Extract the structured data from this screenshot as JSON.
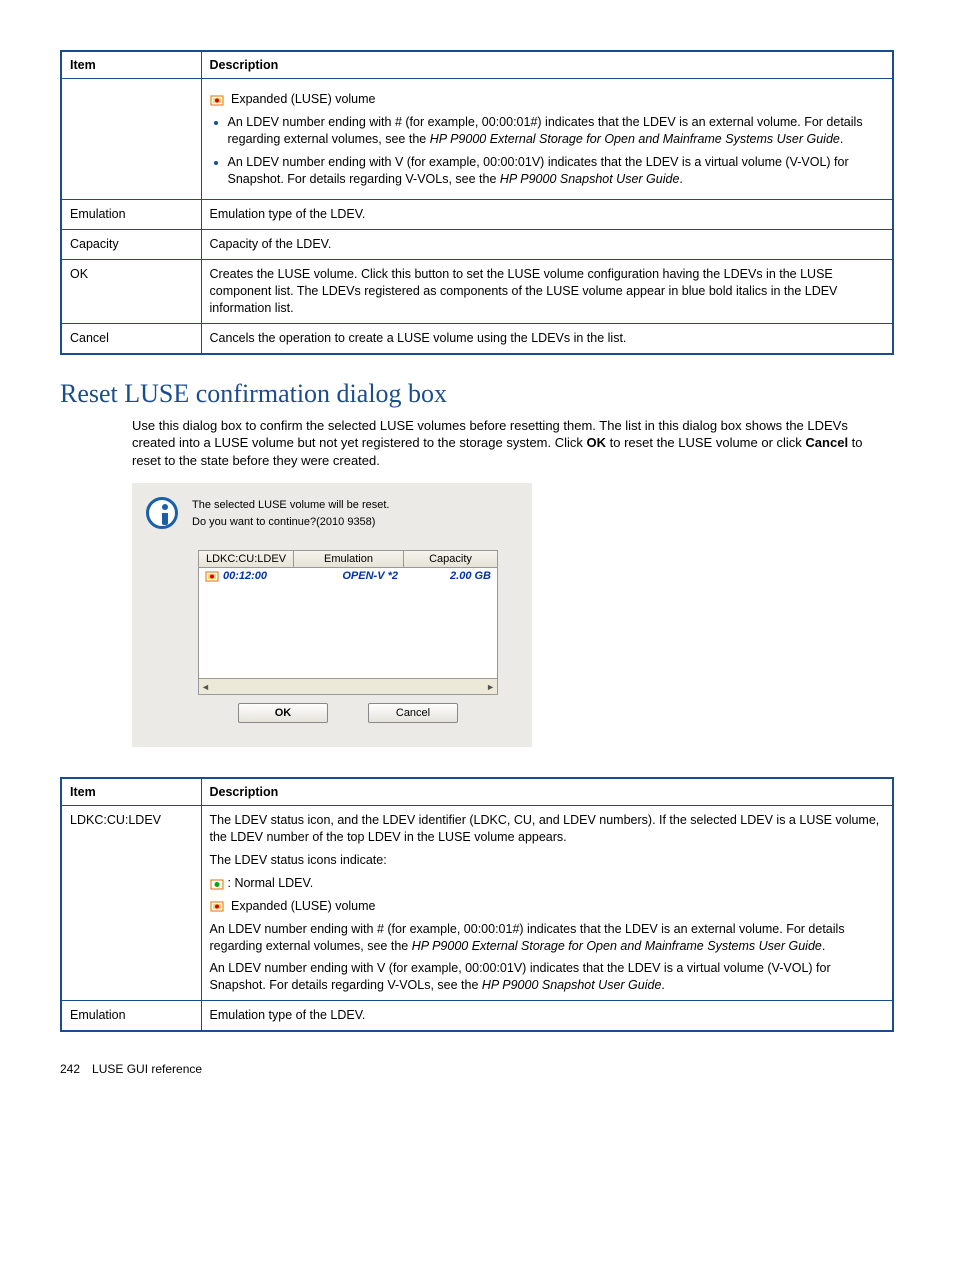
{
  "table1": {
    "headers": {
      "item": "Item",
      "desc": "Description"
    },
    "row_expanded_label": "Expanded (LUSE) volume",
    "bullet1_a": "An LDEV number ending with # (for example, 00:00:01#) indicates that the LDEV is an external volume. For details regarding external volumes, see the ",
    "bullet1_ref": "HP P9000 External Storage for Open and Mainframe Systems User Guide",
    "bullet1_b": ".",
    "bullet2_a": "An LDEV number ending with V (for example, 00:00:01V) indicates that the LDEV is a virtual volume (V-VOL) for Snapshot. For details regarding V-VOLs, see the ",
    "bullet2_ref": "HP P9000 Snapshot User Guide",
    "bullet2_b": ".",
    "emul_item": "Emulation",
    "emul_desc": "Emulation type of the LDEV.",
    "cap_item": "Capacity",
    "cap_desc": "Capacity of the LDEV.",
    "ok_item": "OK",
    "ok_desc": "Creates the LUSE volume. Click this button to set the LUSE volume configuration having the LDEVs in the LUSE component list. The LDEVs registered as components of the LUSE volume appear in blue bold italics in the LDEV information list.",
    "cancel_item": "Cancel",
    "cancel_desc": "Cancels the operation to create a LUSE volume using the LDEVs in the list."
  },
  "section_title": "Reset LUSE confirmation dialog box",
  "section_body_a": "Use this dialog box to confirm the selected LUSE volumes before resetting them. The list in this dialog box shows the LDEVs created into a LUSE volume but not yet registered to the storage system. Click ",
  "section_body_ok": "OK",
  "section_body_b": " to reset the LUSE volume or click ",
  "section_body_cancel": "Cancel",
  "section_body_c": " to reset to the state before they were created.",
  "dialog": {
    "msg1": "The selected LUSE volume will be reset.",
    "msg2": "Do you want to continue?(2010 9358)",
    "col1": "LDKC:CU:LDEV",
    "col2": "Emulation",
    "col3": "Capacity",
    "row_ldev": "00:12:00",
    "row_emul": "OPEN-V *2",
    "row_cap": "2.00 GB",
    "btn_ok": "OK",
    "btn_cancel": "Cancel"
  },
  "table2": {
    "headers": {
      "item": "Item",
      "desc": "Description"
    },
    "ldkc_item": "LDKC:CU:LDEV",
    "ldkc_p1": "The LDEV status icon, and the LDEV identifier (LDKC, CU, and LDEV numbers). If the selected LDEV is a LUSE volume, the LDEV number of the top LDEV in the LUSE volume appears.",
    "ldkc_p2": "The LDEV status icons indicate:",
    "ldkc_normal": ": Normal LDEV.",
    "ldkc_expanded": "Expanded (LUSE) volume",
    "ldkc_p3_a": "An LDEV number ending with # (for example, 00:00:01#) indicates that the LDEV is an external volume. For details regarding external volumes, see the ",
    "ldkc_p3_ref": "HP P9000 External Storage for Open and Mainframe Systems User Guide",
    "ldkc_p3_b": ".",
    "ldkc_p4_a": "An LDEV number ending with V (for example, 00:00:01V) indicates that the LDEV is a virtual volume (V-VOL) for Snapshot. For details regarding V-VOLs, see the ",
    "ldkc_p4_ref": "HP P9000 Snapshot User Guide",
    "ldkc_p4_b": ".",
    "emul_item": "Emulation",
    "emul_desc": "Emulation type of the LDEV."
  },
  "footer": {
    "page": "242",
    "title": "LUSE GUI reference"
  }
}
